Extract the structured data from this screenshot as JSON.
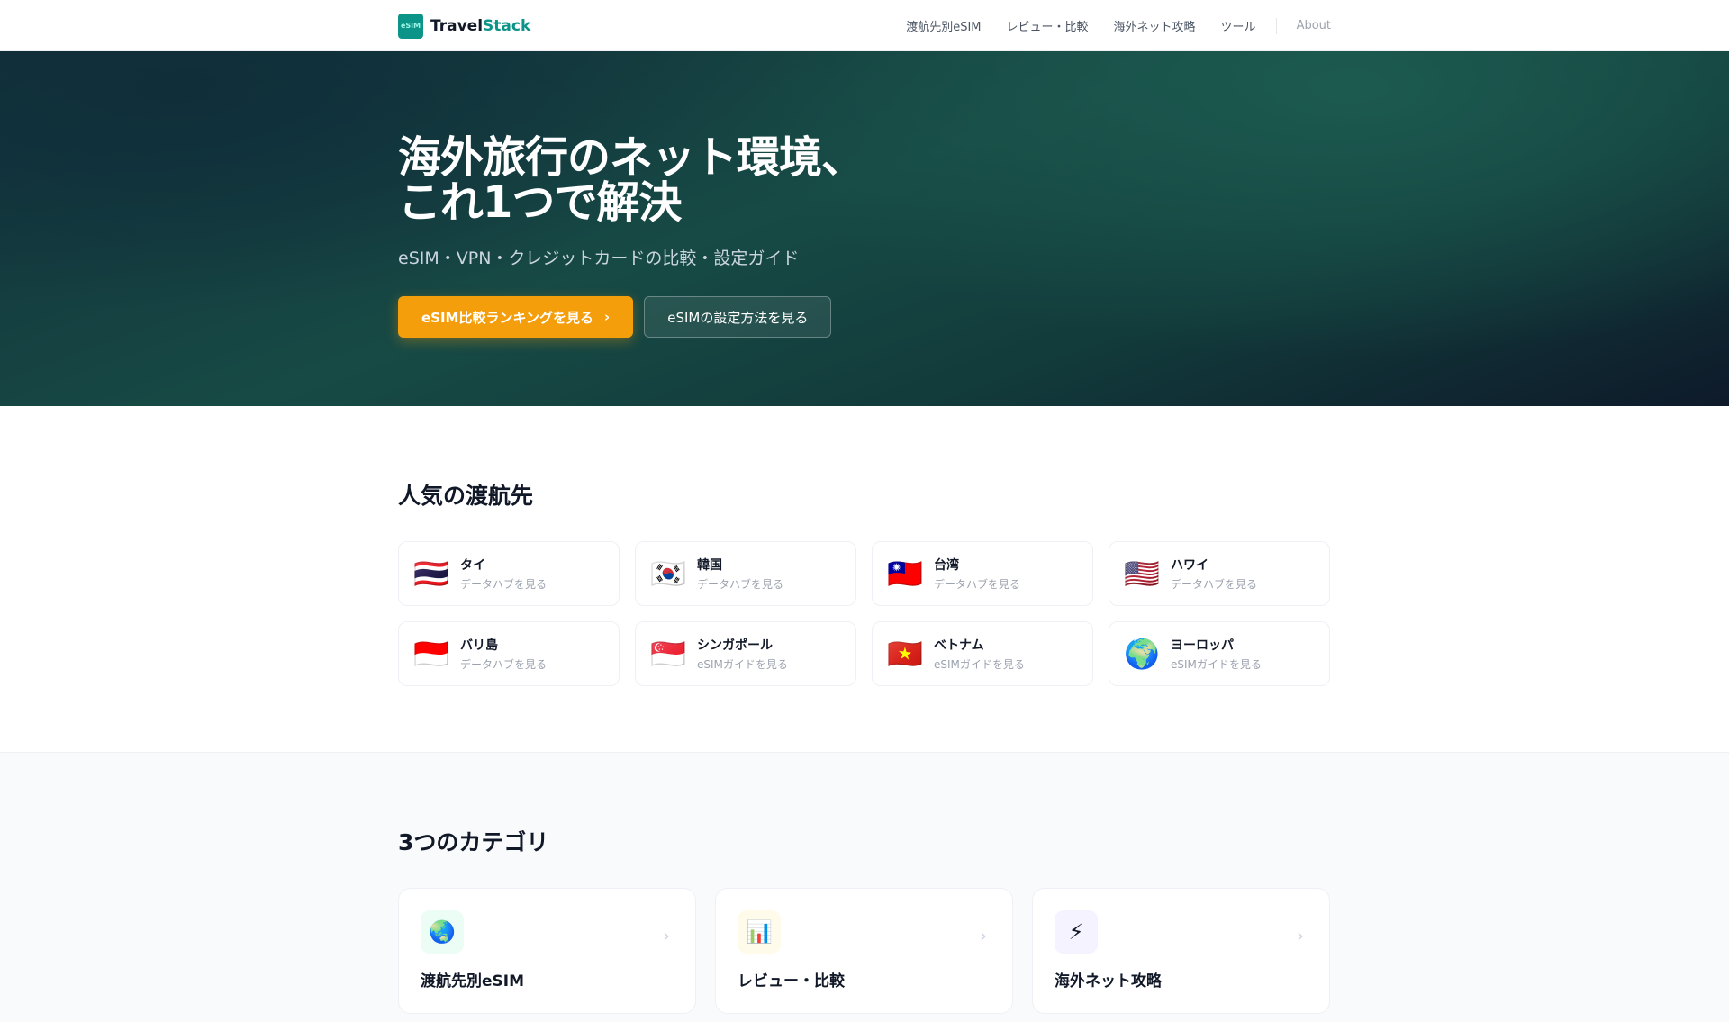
{
  "header": {
    "logo_a": "Travel",
    "logo_b": "Stack",
    "logo_mark": "eSIM",
    "nav": [
      "渡航先別eSIM",
      "レビュー・比較",
      "海外ネット攻略",
      "ツール"
    ],
    "about": "About"
  },
  "hero": {
    "title_1": "海外旅行のネット環境、",
    "title_2": "これ1つで解決",
    "subtitle": "eSIM・VPN・クレジットカードの比較・設定ガイド",
    "primary": "eSIM比較ランキングを見る",
    "secondary": "eSIMの設定方法を見る"
  },
  "popular": {
    "title": "人気の渡航先",
    "items": [
      {
        "flag": "🇹🇭",
        "name": "タイ",
        "sub": "データハブを見る"
      },
      {
        "flag": "🇰🇷",
        "name": "韓国",
        "sub": "データハブを見る"
      },
      {
        "flag": "🇹🇼",
        "name": "台湾",
        "sub": "データハブを見る"
      },
      {
        "flag": "🇺🇸",
        "name": "ハワイ",
        "sub": "データハブを見る"
      },
      {
        "flag": "🇮🇩",
        "name": "バリ島",
        "sub": "データハブを見る"
      },
      {
        "flag": "🇸🇬",
        "name": "シンガポール",
        "sub": "eSIMガイドを見る"
      },
      {
        "flag": "🇻🇳",
        "name": "ベトナム",
        "sub": "eSIMガイドを見る"
      },
      {
        "flag": "🌍",
        "name": "ヨーロッパ",
        "sub": "eSIMガイドを見る"
      }
    ]
  },
  "categories": {
    "title": "3つのカテゴリ",
    "items": [
      {
        "icon": "🌏",
        "title": "渡航先別eSIM",
        "bg": "#ecfdf5"
      },
      {
        "icon": "📊",
        "title": "レビュー・比較",
        "bg": "#fffbeb"
      },
      {
        "icon": "⚡",
        "title": "海外ネット攻略",
        "bg": "#f5f3ff"
      }
    ]
  }
}
